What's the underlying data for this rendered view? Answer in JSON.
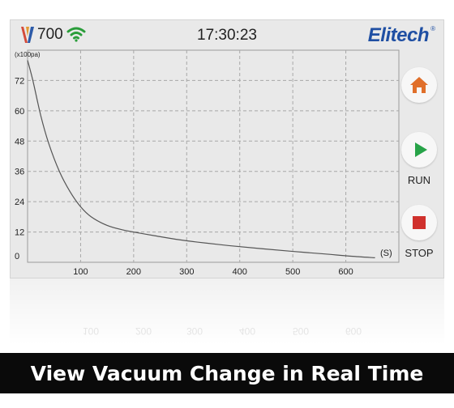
{
  "status": {
    "reading_value": "700",
    "time": "17:30:23",
    "brand": "Elitech",
    "brand_mark": "®",
    "colors": {
      "wifi": "#2a9d3a",
      "brand": "#1f4fa3",
      "home": "#e06f2a",
      "run": "#27a348",
      "stop": "#d0312d"
    }
  },
  "icons": [
    "gauge-logo-icon",
    "wifi-icon",
    "home-icon",
    "play-icon",
    "stop-icon"
  ],
  "controls": {
    "run_label": "RUN",
    "stop_label": "STOP"
  },
  "caption": "View Vacuum Change in Real Time",
  "chart_data": {
    "type": "line",
    "title": "",
    "xlabel": "(S)",
    "ylabel": "(x100pa)",
    "xlim": [
      0,
      700
    ],
    "ylim": [
      0,
      84
    ],
    "x_ticks": [
      100,
      200,
      300,
      400,
      500,
      600
    ],
    "y_ticks": [
      0,
      12,
      24,
      36,
      48,
      60,
      72
    ],
    "y_tick_labels": [
      "0",
      "12",
      "24",
      "36",
      "48",
      "60",
      "72"
    ],
    "grid": true,
    "series": [
      {
        "x": [
          0,
          10,
          25,
          40,
          60,
          80,
          100,
          120,
          150,
          180,
          210,
          240,
          280,
          320,
          380,
          440,
          500,
          560,
          610,
          655
        ],
        "y": [
          80,
          72,
          58,
          47,
          36,
          28,
          22,
          18,
          14.6,
          12.8,
          11.6,
          10.5,
          9.1,
          8.0,
          6.6,
          5.4,
          4.3,
          3.3,
          2.4,
          1.8
        ]
      }
    ]
  }
}
